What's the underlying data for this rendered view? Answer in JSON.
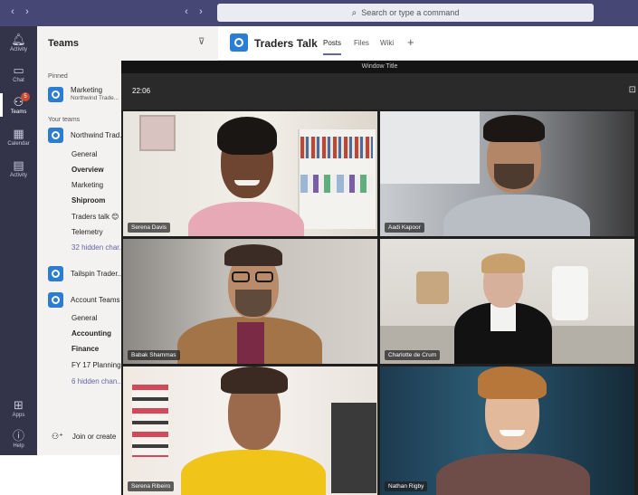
{
  "topbar": {
    "search_placeholder": "Search or type a command"
  },
  "rail": [
    {
      "label": "Activity",
      "icon": "bell-icon"
    },
    {
      "label": "Chat",
      "icon": "chat-icon"
    },
    {
      "label": "Teams",
      "icon": "teams-icon",
      "badge": "5",
      "active": true
    },
    {
      "label": "Calendar",
      "icon": "calendar-icon"
    },
    {
      "label": "Activity",
      "icon": "file-icon"
    },
    {
      "label": "Apps",
      "icon": "apps-icon"
    },
    {
      "label": "Help",
      "icon": "help-icon"
    }
  ],
  "panel": {
    "title": "Teams",
    "pinned_label": "Pinned",
    "your_teams_label": "Your teams",
    "pinned_team": {
      "name": "Marketing",
      "sub": "Northwind Trade..."
    },
    "team1": {
      "name": "Northwind Trad..."
    },
    "team1_channels": [
      "General",
      "Overview",
      "Marketing",
      "Shiproom",
      "Traders talk 😊",
      "Telemetry",
      "32 hidden char..."
    ],
    "team2": {
      "name": "Tailspin Trader..."
    },
    "team3": {
      "name": "Account Teams"
    },
    "team3_channels": [
      "General",
      "Accounting",
      "Finance",
      "FY 17 Planning",
      "6 hidden chan..."
    ],
    "join_create": "Join or create"
  },
  "channel": {
    "title": "Traders Talk",
    "tabs": [
      "Posts",
      "Files",
      "Wiki"
    ],
    "add_tab": "+"
  },
  "meeting": {
    "window_title": "Window Title",
    "timer": "22:06",
    "participants": [
      "Serena Davis",
      "Aadi Kapoor",
      "Babak Shammas",
      "Charlotte de Crum",
      "Serena Ribeiro",
      "Nathan Rigby"
    ]
  },
  "colors": {
    "topbar": "#464775",
    "rail": "#33344a",
    "accent": "#6264a7",
    "team_logo": "#2b7cd3",
    "meeting_bg": "#1f1f1f"
  }
}
